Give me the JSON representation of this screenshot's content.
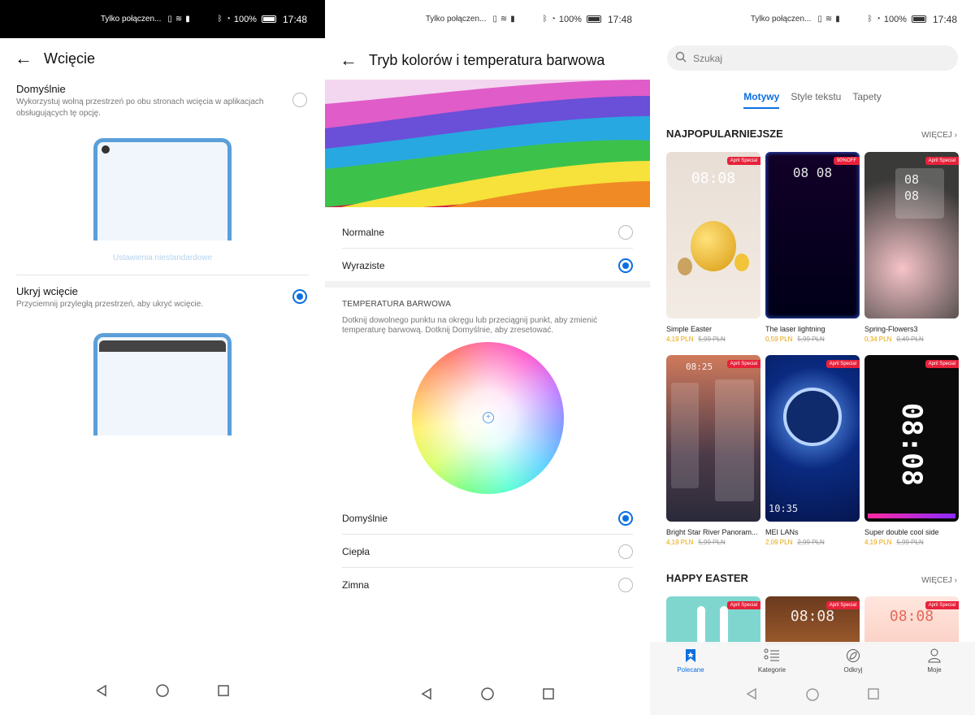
{
  "status": {
    "carrier": "Tylko połączen...",
    "battery": "100%",
    "time": "17:48"
  },
  "panel1": {
    "title": "Wcięcie",
    "option_default": {
      "title": "Domyślnie",
      "desc": "Wykorzystuj wolną przestrzeń po obu stronach wcięcia w aplikacjach obsługujących tę opcję.",
      "selected": false
    },
    "custom_link": "Ustawienia niestandardowe",
    "option_hide": {
      "title": "Ukryj wcięcie",
      "desc": "Przyciemnij przyległą przestrzeń, aby ukryć wcięcie.",
      "selected": true
    }
  },
  "panel2": {
    "title": "Tryb kolorów i temperatura barwowa",
    "modes": [
      {
        "label": "Normalne",
        "selected": false
      },
      {
        "label": "Wyraziste",
        "selected": true
      }
    ],
    "temp_header": "TEMPERATURA BARWOWA",
    "temp_desc": "Dotknij dowolnego punktu na okręgu lub przeciągnij punkt, aby zmienić temperaturę barwową. Dotknij Domyślnie, aby zresetować.",
    "temps": [
      {
        "label": "Domyślnie",
        "selected": true
      },
      {
        "label": "Ciepła",
        "selected": false
      },
      {
        "label": "Zimna",
        "selected": false
      }
    ]
  },
  "panel3": {
    "search_placeholder": "Szukaj",
    "tabs": [
      "Motywy",
      "Style tekstu",
      "Tapety"
    ],
    "active_tab": "Motywy",
    "section1": "NAJPOPULARNIEJSZE",
    "section2": "HAPPY EASTER",
    "more": "WIĘCEJ",
    "themes": [
      {
        "name": "Simple Easter",
        "price": "4,19 PLN",
        "old": "5,99 PLN",
        "badge": "April Special",
        "clock": "08:08"
      },
      {
        "name": "The laser lightning",
        "price": "0,59 PLN",
        "old": "5,99 PLN",
        "badge": "90%OFF",
        "clock": "08 08"
      },
      {
        "name": "Spring-Flowers3",
        "price": "0,34 PLN",
        "old": "0,49 PLN",
        "badge": "April Special",
        "clock": "08 08"
      },
      {
        "name": "Bright Star River Panoram...",
        "price": "4,19 PLN",
        "old": "5,99 PLN",
        "badge": "April Special",
        "clock": "08:25"
      },
      {
        "name": "MEI LANs",
        "price": "2,09 PLN",
        "old": "2,99 PLN",
        "badge": "April Special",
        "clock": "10:35"
      },
      {
        "name": "Super double cool side",
        "price": "4,19 PLN",
        "old": "5,99 PLN",
        "badge": "April Special",
        "clock": "08:08"
      }
    ],
    "easter": [
      {
        "badge": "April Special",
        "clock": ""
      },
      {
        "badge": "April Special",
        "clock": "08:08"
      },
      {
        "badge": "April Special",
        "clock": "08:08"
      }
    ],
    "bottom_nav": [
      {
        "label": "Polecane",
        "icon": "star-bookmark-icon",
        "active": true
      },
      {
        "label": "Kategorie",
        "icon": "list-icon",
        "active": false
      },
      {
        "label": "Odkryj",
        "icon": "leaf-icon",
        "active": false
      },
      {
        "label": "Moje",
        "icon": "person-icon",
        "active": false
      }
    ]
  },
  "colors": {
    "accent": "#0a6fe0",
    "price": "#e8a200",
    "badge": "#e8213a",
    "phone_frame": "#5b9fd9"
  }
}
